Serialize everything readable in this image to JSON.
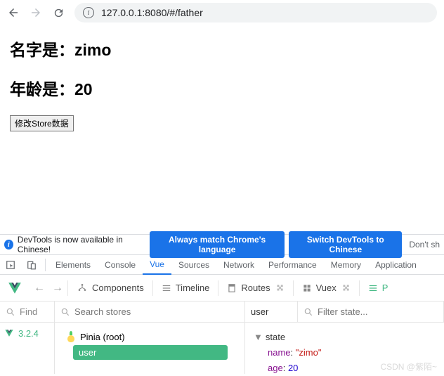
{
  "browser": {
    "url": "127.0.0.1:8080/#/father"
  },
  "page": {
    "name_label": "名字是：",
    "name_value": "zimo",
    "age_label": "年龄是：",
    "age_value": "20",
    "modify_button": "修改Store数据"
  },
  "dt_notice": {
    "text": "DevTools is now available in Chinese!",
    "always_match": "Always match Chrome's language",
    "switch": "Switch DevTools to Chinese",
    "dont_show": "Don't sh"
  },
  "dt_tabs": {
    "elements": "Elements",
    "console": "Console",
    "vue": "Vue",
    "sources": "Sources",
    "network": "Network",
    "performance": "Performance",
    "memory": "Memory",
    "application": "Application"
  },
  "vue_bar": {
    "components": "Components",
    "timeline": "Timeline",
    "routes": "Routes",
    "vuex": "Vuex",
    "pinia_tab": "P"
  },
  "search_row": {
    "find": "Find",
    "search_stores_ph": "Search stores",
    "store_name": "user",
    "filter_state_ph": "Filter state..."
  },
  "panel1": {
    "version": "3.2.4"
  },
  "panel2": {
    "pinia_label": "Pinia (root)",
    "user_label": "user"
  },
  "panel3": {
    "state_label": "state",
    "name_key": "name",
    "name_val": "\"zimo\"",
    "age_key": "age",
    "age_val": "20"
  },
  "watermark": "CSDN @紫陌~"
}
